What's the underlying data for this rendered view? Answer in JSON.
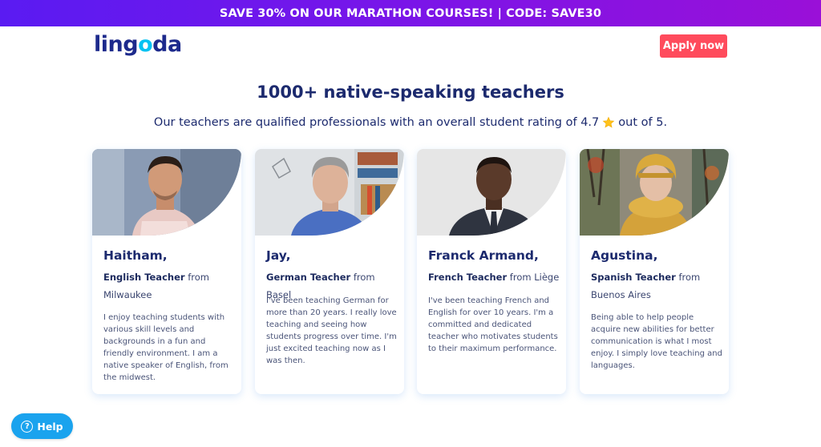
{
  "promo": {
    "text": "SAVE 30% ON OUR MARATHON COURSES! | CODE: SAVE30"
  },
  "header": {
    "logo_parts": [
      "ling",
      "o",
      "da"
    ],
    "apply_label": "Apply now"
  },
  "hero": {
    "title": "1000+ native-speaking teachers",
    "subtitle_before": "Our teachers are qualified professionals with an overall student rating of 4.7",
    "subtitle_after": "out of 5.",
    "star_icon": "star-icon"
  },
  "teachers": [
    {
      "name": "Haitham,",
      "role": "English Teacher",
      "from_word": "from",
      "location": "Milwaukee",
      "bio": "I enjoy teaching students with various skill levels and backgrounds in a fun and friendly environment. I am a native speaker of English, from the midwest."
    },
    {
      "name": "Jay,",
      "role": "German Teacher",
      "from_word": "from",
      "location": "Basel",
      "bio": "I've been teaching German for more than 20 years. I really love teaching and seeing how students progress over time. I'm just excited teaching now as I was then."
    },
    {
      "name": "Franck Armand,",
      "role": "French Teacher",
      "from_word": "from",
      "location": "Liège",
      "bio": "I've been teaching French and English for over 10 years. I'm a committed and dedicated teacher who motivates students to their maximum performance."
    },
    {
      "name": "Agustina,",
      "role": "Spanish Teacher",
      "from_word": "from",
      "location": "Buenos Aires",
      "bio": "Being able to help people acquire new abilities for better communication is what I most enjoy. I simply love teaching and languages."
    }
  ],
  "help": {
    "label": "Help",
    "icon": "question-icon"
  },
  "colors": {
    "brand": "#1d2a8c",
    "accent": "#00c2f2",
    "cta": "#ff4b5c",
    "help": "#1aa3ee",
    "promo_start": "#5a1bf2",
    "promo_end": "#9a10d8"
  }
}
